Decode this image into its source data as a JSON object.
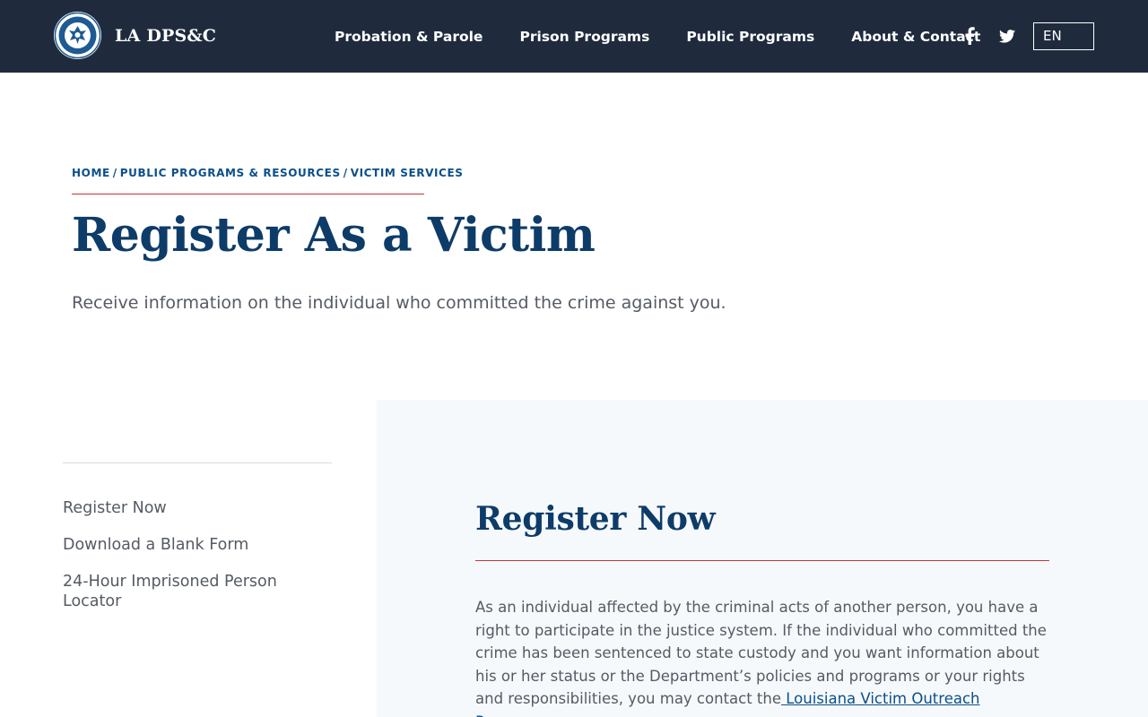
{
  "header": {
    "brand_name": "LA DPS&C",
    "nav": [
      {
        "label": "Probation & Parole"
      },
      {
        "label": "Prison Programs"
      },
      {
        "label": "Public Programs"
      },
      {
        "label": "About & Contact"
      }
    ],
    "social_icons": [
      "facebook-icon",
      "twitter-icon"
    ],
    "language": "EN"
  },
  "breadcrumb": {
    "items": [
      "HOME",
      "PUBLIC PROGRAMS & RESOURCES",
      "VICTIM SERVICES"
    ],
    "separator": "/"
  },
  "hero": {
    "title": "Register As a Victim",
    "subtitle": "Receive information on the individual who committed the crime against you."
  },
  "sidebar": {
    "items": [
      {
        "label": "Register Now"
      },
      {
        "label": "Download a Blank Form"
      },
      {
        "label": "24-Hour Imprisoned Person Locator"
      }
    ]
  },
  "main": {
    "section_title": "Register Now",
    "body_text": "As an individual affected by the criminal acts of another person, you have a right to participate in the justice system. If the individual who committed the crime has been sentenced to state custody and you want information about his or her status or the Department’s policies and programs or your rights and responsibilities, you may contact the",
    "link_text": " Louisiana Victim Outreach Program."
  },
  "colors": {
    "header_bg": "#1f2b3d",
    "title_navy": "#0e3c69",
    "link_blue": "#0b4f8a",
    "accent_red": "#c8333d",
    "panel_bg": "#f6f9fc"
  }
}
